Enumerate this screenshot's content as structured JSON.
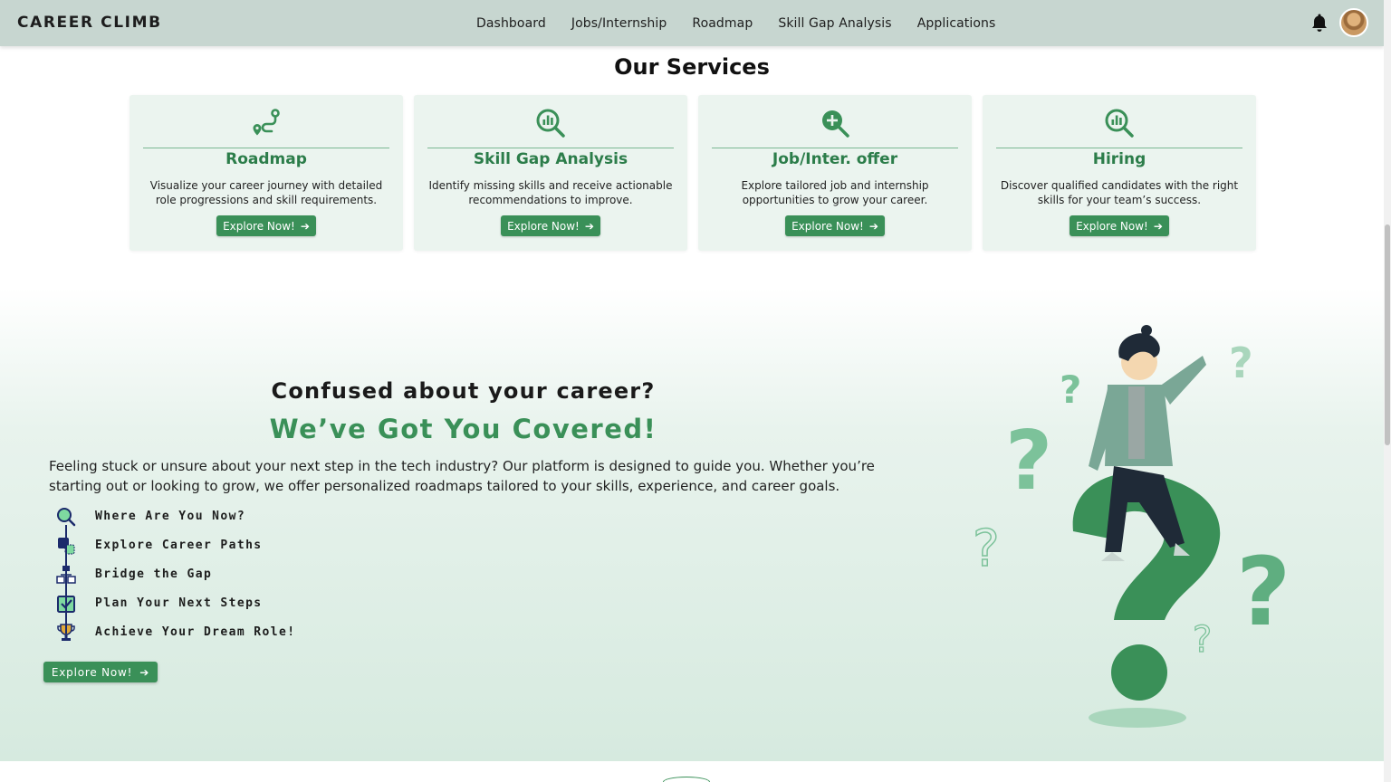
{
  "header": {
    "brand": "CAREER CLIMB",
    "nav": [
      "Dashboard",
      "Jobs/Internship",
      "Roadmap",
      "Skill Gap Analysis",
      "Applications"
    ],
    "notification_icon": "bell-icon",
    "avatar": "user-avatar"
  },
  "services": {
    "title": "Our Services",
    "cards": [
      {
        "icon": "route-icon",
        "title": "Roadmap",
        "desc": "Visualize your career journey with detailed role progressions and skill requirements.",
        "button": "Explore Now!"
      },
      {
        "icon": "chart-search-icon",
        "title": "Skill Gap Analysis",
        "desc": "Identify missing skills and receive actionable recommendations to improve.",
        "button": "Explore Now!"
      },
      {
        "icon": "zoom-plus-icon",
        "title": "Job/Inter. offer",
        "desc": "Explore tailored job and internship opportunities to grow your career.",
        "button": "Explore Now!"
      },
      {
        "icon": "chart-search-icon",
        "title": "Hiring",
        "desc": "Discover qualified candidates with the right skills for your team’s success.",
        "button": "Explore Now!"
      }
    ]
  },
  "hero": {
    "question": "Confused about your career?",
    "headline": "We’ve Got You Covered!",
    "paragraph": "Feeling stuck or unsure about your next step in the tech industry? Our platform is designed to guide you. Whether you’re starting out or looking to grow, we offer personalized roadmaps tailored to your skills, experience, and career goals.",
    "steps": [
      {
        "icon": "search-icon",
        "label": "Where Are You Now?"
      },
      {
        "icon": "paths-icon",
        "label": "Explore Career Paths"
      },
      {
        "icon": "hierarchy-icon",
        "label": "Bridge the Gap"
      },
      {
        "icon": "checkbox-icon",
        "label": "Plan Your Next Steps"
      },
      {
        "icon": "trophy-icon",
        "label": "Achieve Your Dream Role!"
      }
    ],
    "button": "Explore Now!"
  },
  "colors": {
    "accent": "#3a9058",
    "header_bg": "#c7d6d0",
    "card_bg": "#ebf4ef",
    "title_green": "#2c7d4a"
  }
}
